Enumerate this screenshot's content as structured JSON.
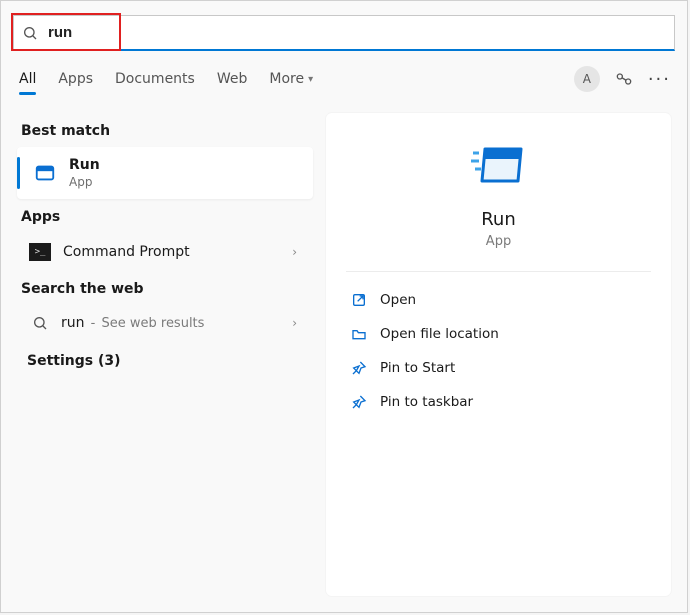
{
  "search": {
    "value": "run"
  },
  "tabs": {
    "all": "All",
    "apps": "Apps",
    "documents": "Documents",
    "web": "Web",
    "more": "More"
  },
  "avatar_letter": "A",
  "left": {
    "best_match_label": "Best match",
    "best_match": {
      "title": "Run",
      "subtitle": "App"
    },
    "apps_label": "Apps",
    "apps": [
      {
        "title": "Command Prompt"
      }
    ],
    "search_web_label": "Search the web",
    "web": {
      "query": "run",
      "separator": " - ",
      "suffix": "See web results"
    },
    "settings": {
      "label": "Settings (3)"
    }
  },
  "right": {
    "title": "Run",
    "subtitle": "App",
    "actions": {
      "open": "Open",
      "open_location": "Open file location",
      "pin_start": "Pin to Start",
      "pin_taskbar": "Pin to taskbar"
    }
  }
}
